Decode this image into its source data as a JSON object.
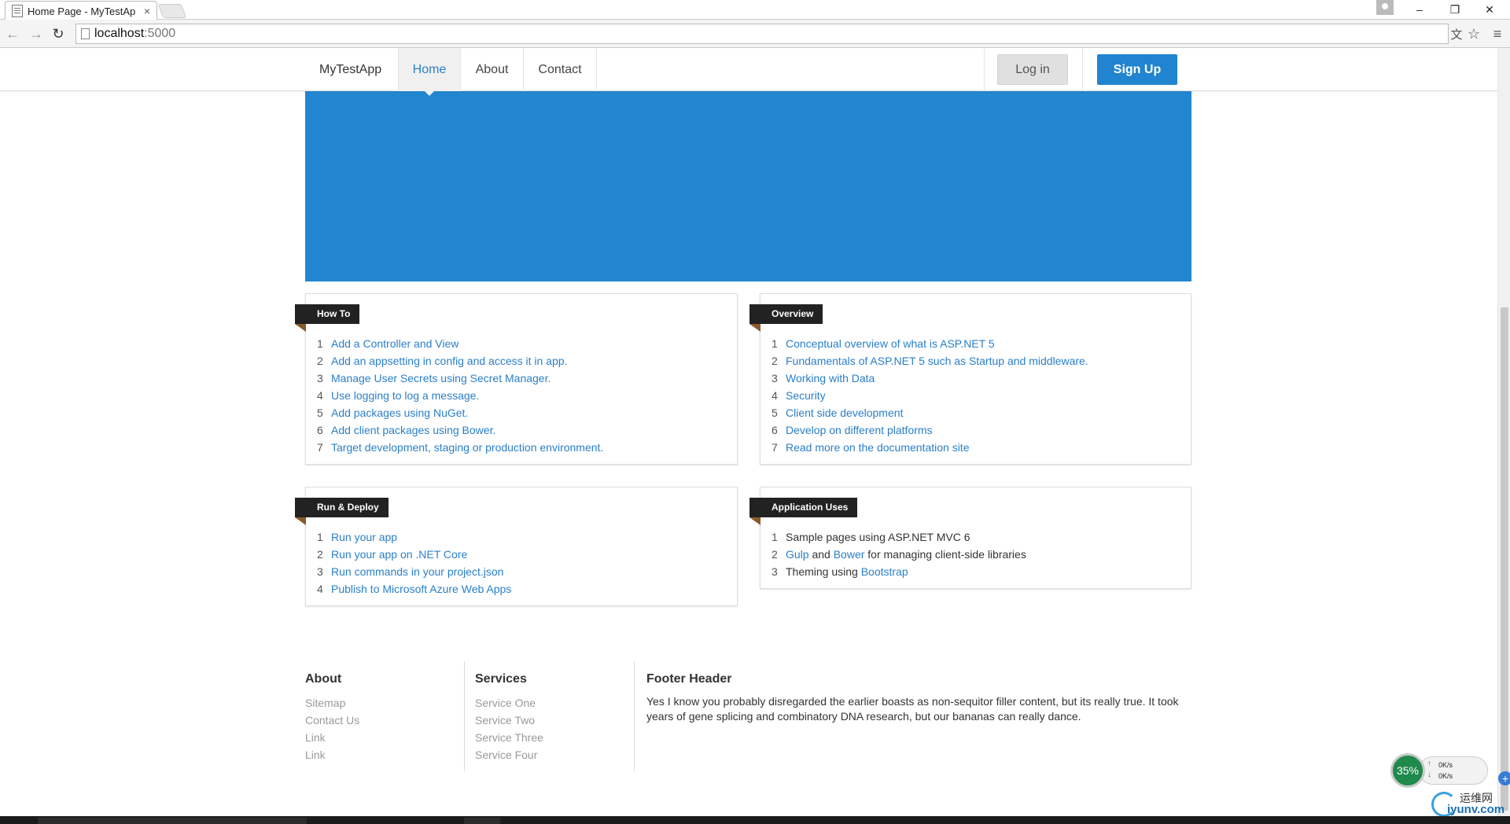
{
  "browser": {
    "tab_title": "Home Page - MyTestAp",
    "tab_close": "×",
    "url_host": "localhost",
    "url_port": ":5000",
    "back_glyph": "←",
    "forward_glyph": "→",
    "reload_glyph": "↻",
    "minimize_glyph": "–",
    "restore_glyph": "❐",
    "close_glyph": "✕",
    "translate_glyph": "文",
    "star_glyph": "☆",
    "menu_glyph": "≡"
  },
  "nav": {
    "brand": "MyTestApp",
    "links": [
      "Home",
      "About",
      "Contact"
    ],
    "active": "Home",
    "login": "Log in",
    "signup": "Sign Up",
    "accent_color": "#2184d0"
  },
  "hero": {
    "color": "#2386d1"
  },
  "panels": {
    "howto": {
      "label": "How To",
      "items": [
        "Add a Controller and View",
        "Add an appsetting in config and access it in app.",
        "Manage User Secrets using Secret Manager.",
        "Use logging to log a message.",
        "Add packages using NuGet.",
        "Add client packages using Bower.",
        "Target development, staging or production environment."
      ]
    },
    "overview": {
      "label": "Overview",
      "items": [
        "Conceptual overview of what is ASP.NET 5",
        "Fundamentals of ASP.NET 5 such as Startup and middleware.",
        "Working with Data",
        "Security",
        "Client side development",
        "Develop on different platforms",
        "Read more on the documentation site"
      ]
    },
    "deploy": {
      "label": "Run & Deploy",
      "items": [
        "Run your app",
        "Run your app on .NET Core",
        "Run commands in your project.json",
        "Publish to Microsoft Azure Web Apps"
      ]
    },
    "uses": {
      "label": "Application Uses",
      "item1": "Sample pages using ASP.NET MVC 6",
      "item2_link1": "Gulp",
      "item2_and": " and ",
      "item2_link2": "Bower",
      "item2_rest": " for managing client-side libraries",
      "item3_text": "Theming using ",
      "item3_link": "Bootstrap"
    }
  },
  "footer": {
    "about": {
      "title": "About",
      "links": [
        "Sitemap",
        "Contact Us",
        "Link",
        "Link"
      ]
    },
    "services": {
      "title": "Services",
      "links": [
        "Service One",
        "Service Two",
        "Service Three",
        "Service Four"
      ]
    },
    "header": {
      "title": "Footer Header",
      "text": "Yes I know you probably disregarded the earlier boasts as non-sequitor filler content, but its really true. It took years of gene splicing and combinatory DNA research, but our bananas can really dance."
    }
  },
  "widget": {
    "percent": "35%",
    "up": "0K/s",
    "down": "0K/s",
    "watermark_cn": "运维网",
    "watermark_en": "iyunv.com"
  }
}
